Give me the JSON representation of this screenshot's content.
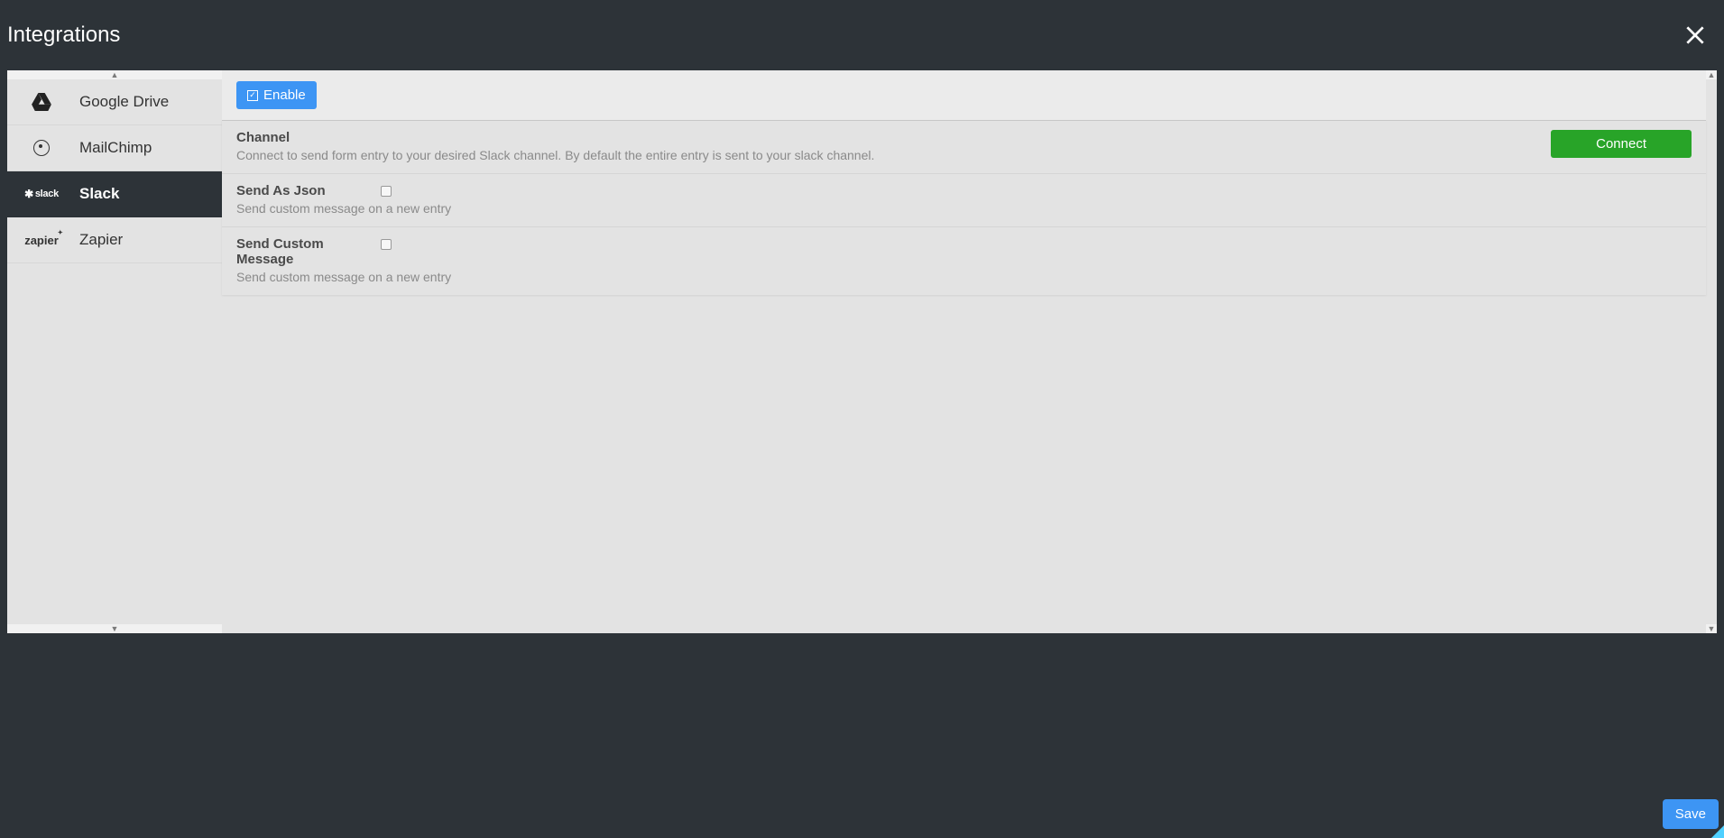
{
  "header": {
    "title": "Integrations"
  },
  "sidebar": {
    "items": [
      {
        "label": "Google Drive"
      },
      {
        "label": "MailChimp"
      },
      {
        "label": "Slack"
      },
      {
        "label": "Zapier"
      }
    ]
  },
  "main": {
    "enable_label": "Enable",
    "channel": {
      "title": "Channel",
      "desc": "Connect to send form entry to your desired Slack channel. By default the entire entry is sent to your slack channel.",
      "connect_label": "Connect"
    },
    "send_json": {
      "title": "Send As Json",
      "desc": "Send custom message on a new entry"
    },
    "send_custom": {
      "title": "Send Custom Message",
      "desc": "Send custom message on a new entry"
    }
  },
  "footer": {
    "save_label": "Save"
  }
}
